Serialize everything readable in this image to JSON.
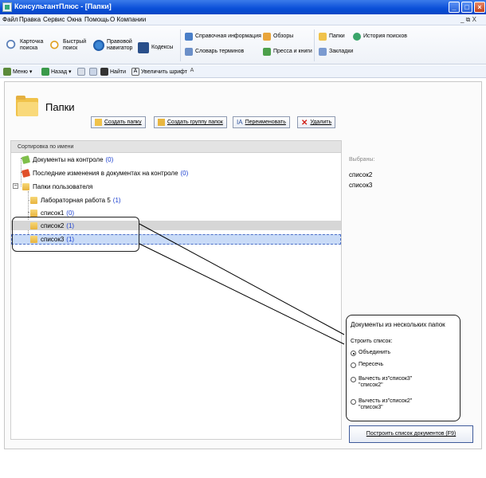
{
  "window": {
    "title": "КонсультантПлюс - [Папки]"
  },
  "menu": {
    "items": [
      "Файл",
      "Правка",
      "Сервис",
      "Окна",
      "Помощь",
      "О Компании"
    ],
    "mdi_controls": "_ ⧉ X"
  },
  "ribbon": {
    "card_search": "Карточка\nпоиска",
    "quick_search": "Быстрый\nпоиск",
    "legal_navigator": "Правовой\nнавигатор",
    "codes": "Кодексы",
    "reference_info": "Справочная информация",
    "glossary": "Словарь терминов",
    "reviews": "Обзоры",
    "press_books": "Пресса и книги",
    "folders": "Папки",
    "bookmarks": "Закладки",
    "search_history": "История поисков"
  },
  "toolbar": {
    "menu": "Меню",
    "back": "Назад",
    "find": "Найти",
    "increase_font": "Увеличить шрифт"
  },
  "page": {
    "title": "Папки",
    "create_folder": "Создать папку",
    "create_group": "Создать группу папок",
    "rename": "Переименовать",
    "delete": "Удалить"
  },
  "tree": {
    "header": "Сортировка по имени",
    "rows": [
      {
        "label": "Документы на контроле",
        "count": "(0)"
      },
      {
        "label": "Последние изменения в документах на контроле",
        "count": "(0)"
      },
      {
        "label": "Папки пользователя",
        "count": ""
      },
      {
        "label": "Лабораторная работа 5",
        "count": "(1)"
      },
      {
        "label": "список1",
        "count": "(0)"
      },
      {
        "label": "список2",
        "count": "(1)"
      },
      {
        "label": "список3",
        "count": "(1)"
      }
    ]
  },
  "selection": {
    "label": "Выбраны:",
    "items": [
      "список2",
      "список3"
    ]
  },
  "combine": {
    "title": "Документы из нескольких папок",
    "subtitle": "Строить список:",
    "options": [
      {
        "label": "Объединить",
        "selected": true
      },
      {
        "label": "Пересечь",
        "selected": false
      },
      {
        "label": "Вычесть из\"список3\"\n\"список2\"",
        "selected": false
      },
      {
        "label": "Вычесть из\"список2\"\n\"список3\"",
        "selected": false
      }
    ],
    "build_button": "Построить список документов (F9)"
  },
  "colors": {
    "titlebar": "#0a4fd8",
    "folder": "#f0c24a",
    "count_blue": "#1a3fd0",
    "selection_focus": "#c9dbf7"
  }
}
